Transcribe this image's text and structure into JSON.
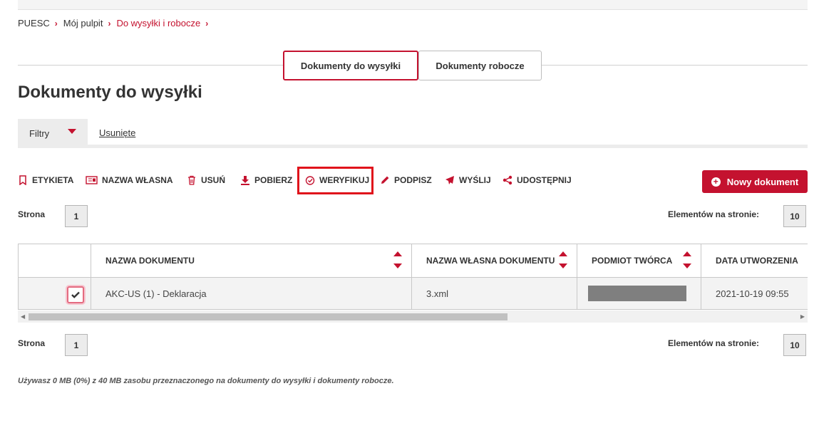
{
  "breadcrumb": [
    "PUESC",
    "Mój pulpit",
    "Do wysyłki i robocze"
  ],
  "tabs": [
    "Dokumenty do wysyłki",
    "Dokumenty robocze"
  ],
  "page_title": "Dokumenty do wysyłki",
  "filters": {
    "filter_label": "Filtry",
    "deleted_label": "Usunięte"
  },
  "toolbar": {
    "label_btn": "ETYKIETA",
    "own_name_btn": "NAZWA WŁASNA",
    "delete_btn": "USUŃ",
    "download_btn": "POBIERZ",
    "verify_btn": "WERYFIKUJ",
    "sign_btn": "PODPISZ",
    "send_btn": "WYŚLIJ",
    "share_btn": "UDOSTĘPNIJ",
    "new_doc_btn": "Nowy dokument"
  },
  "pager": {
    "page_label": "Strona",
    "page_value": "1",
    "per_page_label": "Elementów na stronie:",
    "per_page_value": "10"
  },
  "table": {
    "columns": [
      "NAZWA DOKUMENTU",
      "NAZWA WŁASNA DOKUMENTU",
      "PODMIOT TWÓRCA",
      "DATA UTWORZENIA"
    ],
    "rows": [
      {
        "checked": true,
        "name": "AKC-US (1) - Deklaracja",
        "own_name": "3.xml",
        "creator": "",
        "created": "2021-10-19 09:55"
      }
    ]
  },
  "usage_note": "Używasz 0 MB (0%) z 40 MB zasobu przeznaczonego na dokumenty do wysyłki i dokumenty robocze.",
  "colors": {
    "accent": "#c4122f",
    "highlight_box": "#e0131b"
  }
}
